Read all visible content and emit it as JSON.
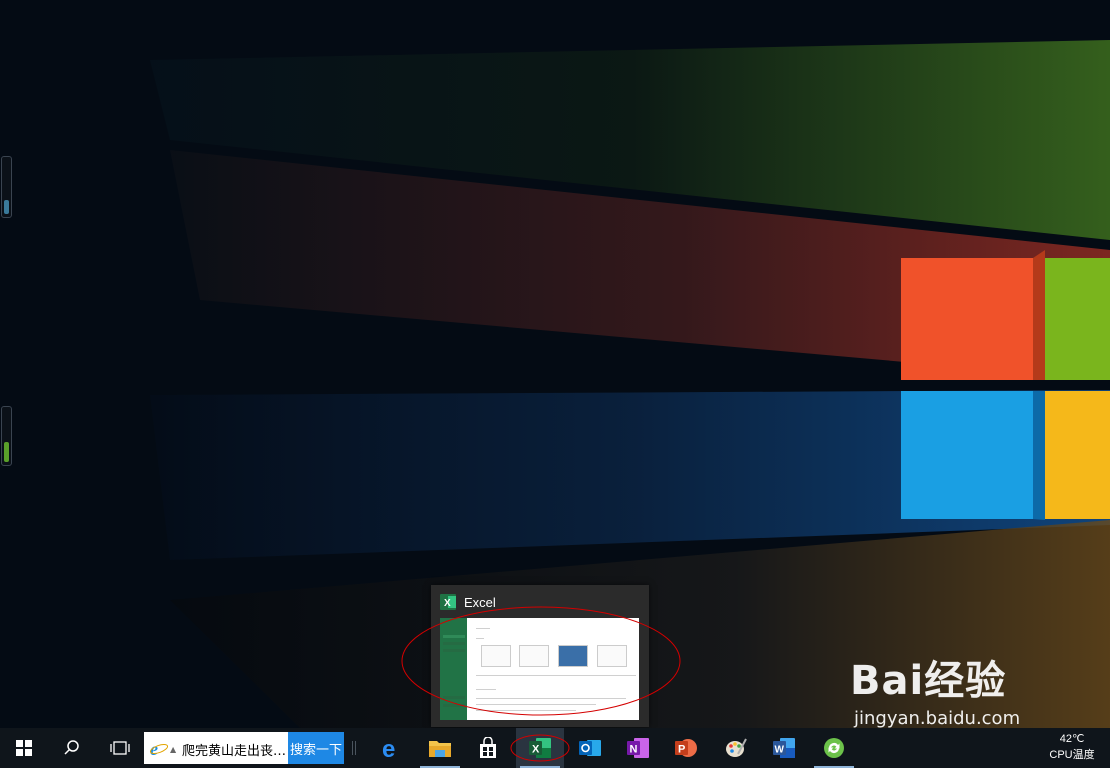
{
  "preview": {
    "title": "Excel"
  },
  "watermark": {
    "brand": "Bai经验",
    "url": "jingyan.baidu.com"
  },
  "taskbar": {
    "search_query": "爬完黄山走出丧…",
    "search_button": "搜索一下",
    "pinned": [
      {
        "name": "edge-icon",
        "running": false
      },
      {
        "name": "file-explorer-icon",
        "running": true
      },
      {
        "name": "store-icon",
        "running": false
      },
      {
        "name": "excel-icon",
        "running": true,
        "active": true
      },
      {
        "name": "outlook-icon",
        "running": false
      },
      {
        "name": "onenote-icon",
        "running": false
      },
      {
        "name": "powerpoint-icon",
        "running": false
      },
      {
        "name": "paint-icon",
        "running": false
      },
      {
        "name": "word-icon",
        "running": false
      },
      {
        "name": "update-icon",
        "running": true
      }
    ],
    "tray": {
      "temp": "42℃",
      "temp_label": "CPU温度"
    }
  },
  "colors": {
    "highlight_ellipse": "#d40000",
    "excel_green": "#217346",
    "taskbar": "#0f151b"
  }
}
